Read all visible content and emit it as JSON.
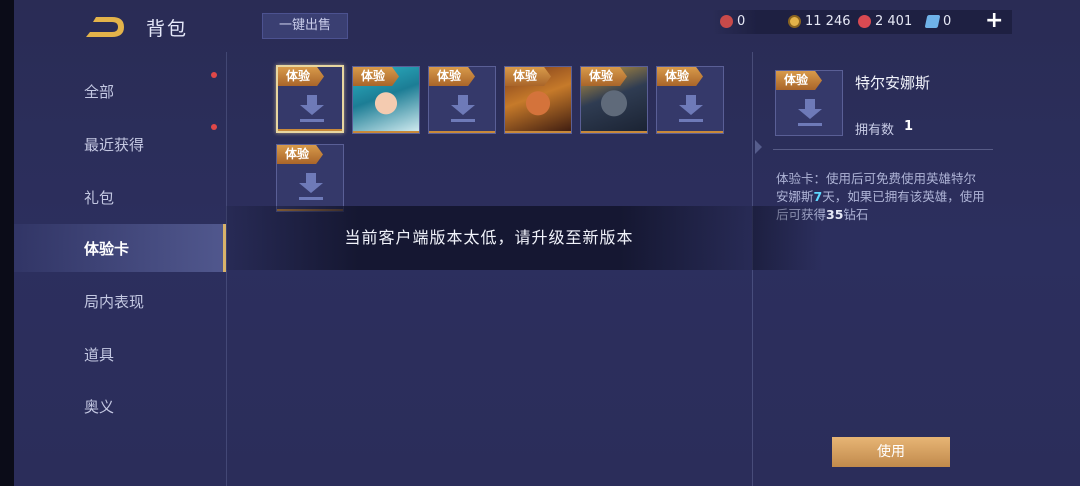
{
  "header": {
    "title": "背包",
    "sell_all_label": "一键出售",
    "add_label": "+"
  },
  "currencies": [
    {
      "icon": "red-token-icon",
      "value": "0",
      "color": "#c84a4a"
    },
    {
      "icon": "gold-coin-icon",
      "value": "11 246",
      "color": "#e3b34a"
    },
    {
      "icon": "gem-icon",
      "value": "2 401",
      "color": "#d94a52"
    },
    {
      "icon": "ticket-icon",
      "value": "0",
      "color": "#6fb2e8"
    }
  ],
  "sidebar": {
    "items": [
      {
        "label": "全部",
        "badge": true
      },
      {
        "label": "最近获得",
        "badge": true
      },
      {
        "label": "礼包",
        "badge": false
      },
      {
        "label": "体验卡",
        "active": true
      },
      {
        "label": "局内表现",
        "badge": false
      },
      {
        "label": "道具",
        "badge": false
      },
      {
        "label": "奥义",
        "badge": false
      }
    ]
  },
  "items": {
    "tag_label": "体验",
    "cards": [
      {
        "kind": "placeholder",
        "selected": true
      },
      {
        "kind": "hero"
      },
      {
        "kind": "placeholder"
      },
      {
        "kind": "hero"
      },
      {
        "kind": "hero"
      },
      {
        "kind": "placeholder"
      },
      {
        "kind": "placeholder"
      }
    ]
  },
  "detail": {
    "name": "特尔安娜斯",
    "owned_label": "拥有数",
    "owned_count": "1",
    "desc_part1": "体验卡：使用后可免费使用英雄特尔安娜斯",
    "desc_days": "7",
    "desc_part2": "天，如果已拥有该英雄，使用后可获得",
    "desc_diamonds": "35",
    "desc_part3": "钻石",
    "use_label": "使用"
  },
  "toast": {
    "message": "当前客户端版本太低，请升级至新版本"
  },
  "colors": {
    "accent_gold": "#d9b36a",
    "tag_orange": "#c8893a",
    "highlight_blue": "#5fd8ff",
    "background": "#2b2d5a"
  }
}
